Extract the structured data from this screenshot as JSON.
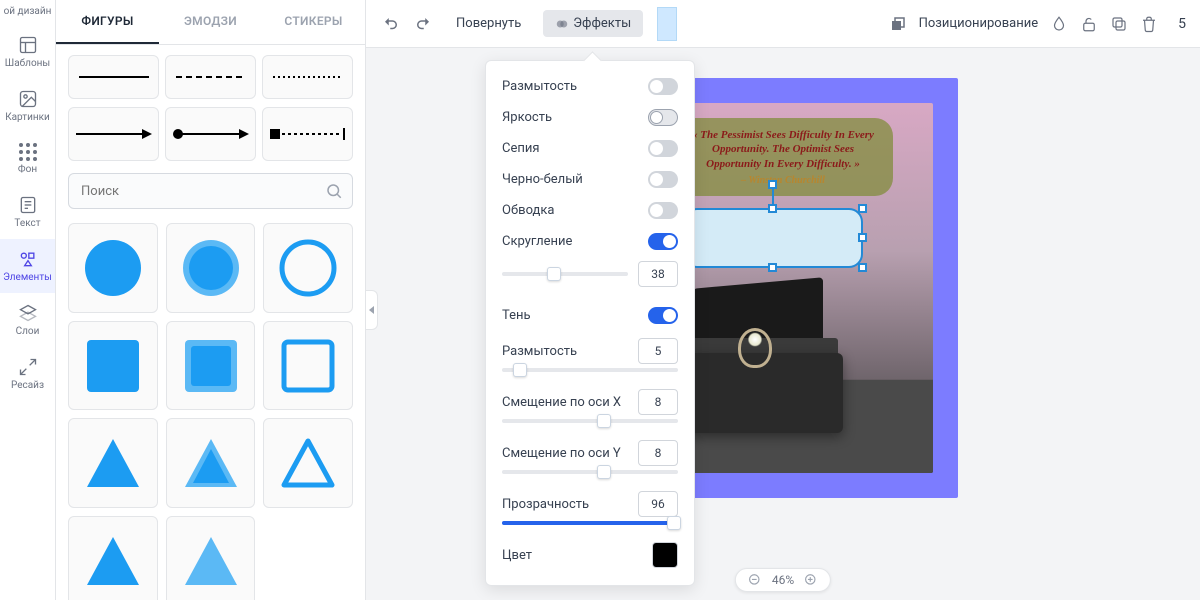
{
  "sidebar": {
    "top": "ой дизайн",
    "items": [
      {
        "label": "Шаблоны"
      },
      {
        "label": "Картинки"
      },
      {
        "label": "Фон"
      },
      {
        "label": "Текст"
      },
      {
        "label": "Элементы"
      },
      {
        "label": "Слои"
      },
      {
        "label": "Ресайз"
      }
    ]
  },
  "panel": {
    "tabs": {
      "shapes": "ФИГУРЫ",
      "emoji": "ЭМОДЗИ",
      "stickers": "СТИКЕРЫ"
    },
    "search_placeholder": "Поиск"
  },
  "topbar": {
    "rotate": "Повернуть",
    "effects": "Эффекты",
    "position": "Позиционирование",
    "count": "5"
  },
  "effects": {
    "blur": "Размытость",
    "brightness": "Яркость",
    "sepia": "Сепия",
    "bw": "Черно-белый",
    "border": "Обводка",
    "rounding": "Скругление",
    "rounding_val": "38",
    "shadow": "Тень",
    "sh_blur": "Размытость",
    "sh_blur_val": "5",
    "sh_x": "Смещение по оси X",
    "sh_x_val": "8",
    "sh_y": "Смещение по оси Y",
    "sh_y_val": "8",
    "opacity": "Прозрачность",
    "opacity_val": "96",
    "color": "Цвет"
  },
  "quote": {
    "text": "« The Pessimist Sees Difficulty In Every Opportunity. The Optimist Sees Opportunity In Every Difficulty. »",
    "author": "– Winston Churchill"
  },
  "zoom": "46%"
}
